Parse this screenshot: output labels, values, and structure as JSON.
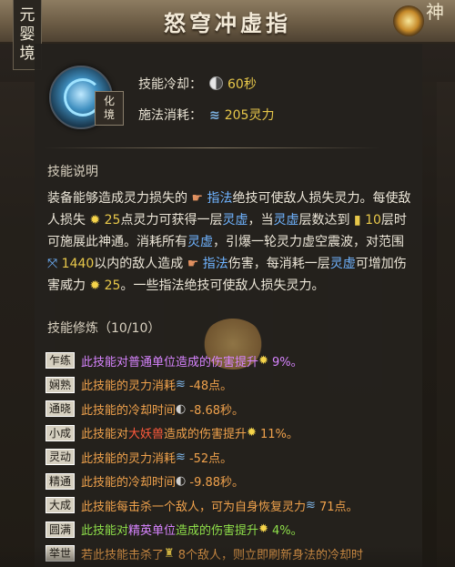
{
  "realm_tag": [
    "元",
    "婴",
    "境"
  ],
  "title": "怒穹冲虚指",
  "corner_text": "神",
  "skill": {
    "realm_badge": [
      "化",
      "境"
    ],
    "cooldown_label": "技能冷却：",
    "cooldown_value": "60秒",
    "cost_label": "施法消耗：",
    "cost_value": "205灵力"
  },
  "description": {
    "title": "技能说明",
    "lines": [
      [
        "装备能够造成灵力损失的 ",
        "☛ ",
        "指法",
        "绝技可使敌人损失灵力。每使敌"
      ],
      [
        "人损失 ",
        "✹ ",
        "25",
        "点灵力可获得一层",
        "灵虚",
        "，当",
        "灵虚",
        "层数达到 ",
        "▮ ",
        "10",
        "层时"
      ],
      [
        "可施展此神通。消耗所有",
        "灵虚",
        "，引爆一轮灵力虚空震波，对范围"
      ],
      [
        "⤧ ",
        "1440",
        "以内的敌人造成 ",
        "☛ ",
        "指法",
        "伤害，每消耗一层",
        "灵虚",
        "可增加伤"
      ],
      [
        "害威力 ",
        "✹ ",
        "25",
        "。一些指法绝技可使敌人损失灵力。"
      ]
    ]
  },
  "training": {
    "title": "技能修炼（10/10）",
    "rows": [
      {
        "tag": "乍练",
        "pre": "此技能对",
        "key": "普通单位",
        "post": "造成的伤害提升 ",
        "icon": "✹",
        "val": "9%。",
        "keyclass": "g1",
        "style": "purple"
      },
      {
        "tag": "娴熟",
        "pre": "此技能的灵力消耗 ",
        "key": "",
        "post": "",
        "icon": "≋",
        "val": "-48点。",
        "keyclass": "",
        "style": "orange"
      },
      {
        "tag": "通晓",
        "pre": "此技能的冷却时间 ",
        "key": "",
        "post": "",
        "icon": "◐",
        "val": "-8.68秒。",
        "keyclass": "",
        "style": "orange"
      },
      {
        "tag": "小成",
        "pre": "此技能对",
        "key": "大妖兽",
        "post": "造成的伤害提升 ",
        "icon": "✹",
        "val": "11%。",
        "keyclass": "g3",
        "style": "orange"
      },
      {
        "tag": "灵动",
        "pre": "此技能的灵力消耗 ",
        "key": "",
        "post": "",
        "icon": "≋",
        "val": "-52点。",
        "keyclass": "",
        "style": "orange"
      },
      {
        "tag": "精通",
        "pre": "此技能的冷却时间 ",
        "key": "",
        "post": "",
        "icon": "◐",
        "val": "-9.88秒。",
        "keyclass": "",
        "style": "orange"
      },
      {
        "tag": "大成",
        "pre": "此技能每击杀一个敌人，可为自身恢复灵力 ",
        "key": "",
        "post": "",
        "icon": "≋",
        "val": "71点。",
        "keyclass": "",
        "style": "orange"
      },
      {
        "tag": "圆满",
        "pre": "此技能对",
        "key": "精英单位",
        "post": "造成的伤害提升 ",
        "icon": "✹",
        "val": "4%。",
        "keyclass": "g4",
        "style": "green"
      },
      {
        "tag": "举世",
        "pre": "若此技能击杀了 ",
        "key": "",
        "post": "",
        "icon": "♜",
        "val": "8个敌人，则立即刷新身法的冷却时",
        "keyclass": "",
        "style": "orange"
      }
    ]
  },
  "colors": {
    "keyword": "#6fb3ff",
    "value": "#e8c84a",
    "orange": "#f0a24c",
    "purple": "#d784ff",
    "green": "#8fe04a"
  }
}
